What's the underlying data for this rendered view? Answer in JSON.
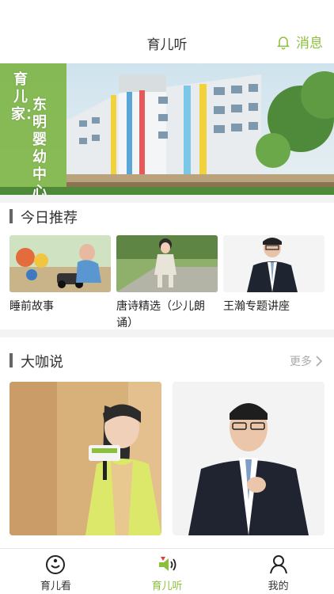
{
  "header": {
    "title": "育儿听",
    "message_label": "消息"
  },
  "banner": {
    "vertical_text_1": "育儿家：",
    "vertical_text_2": "东明婴幼中心"
  },
  "recommend": {
    "title": "今日推荐",
    "items": [
      {
        "label": "睡前故事"
      },
      {
        "label": "唐诗精选（少儿朗诵）"
      },
      {
        "label": "王瀚专题讲座"
      }
    ]
  },
  "talks": {
    "title": "大咖说",
    "more_label": "更多"
  },
  "bottom_nav": {
    "items": [
      {
        "label": "育儿看",
        "icon": "smile-icon"
      },
      {
        "label": "育儿听",
        "icon": "speaker-icon"
      },
      {
        "label": "我的",
        "icon": "user-icon"
      }
    ]
  },
  "colors": {
    "accent": "#8cbf3c",
    "separator": "#f3f3f3"
  }
}
